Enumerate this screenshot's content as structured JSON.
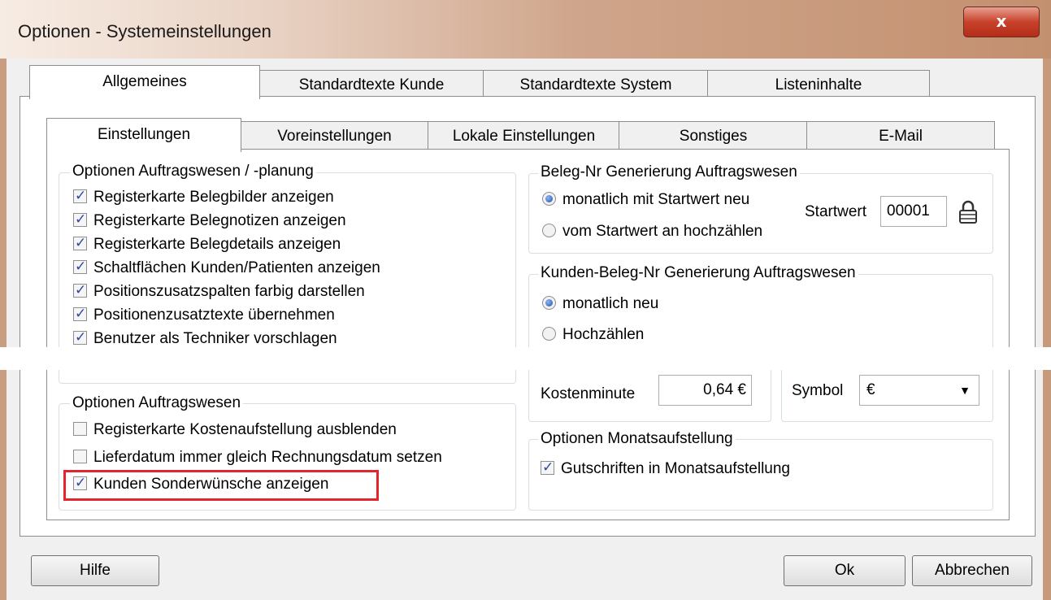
{
  "window": {
    "title": "Optionen - Systemeinstellungen",
    "close": "x"
  },
  "main_tabs": [
    "Allgemeines",
    "Standardtexte Kunde",
    "Standardtexte System",
    "Listeninhalte"
  ],
  "sub_tabs": [
    "Einstellungen",
    "Voreinstellungen",
    "Lokale Einstellungen",
    "Sonstiges",
    "E-Mail"
  ],
  "group_planung": {
    "legend": "Optionen Auftragswesen / -planung",
    "items": [
      {
        "label": "Registerkarte Belegbilder anzeigen",
        "checked": true
      },
      {
        "label": "Registerkarte Belegnotizen anzeigen",
        "checked": true
      },
      {
        "label": "Registerkarte Belegdetails anzeigen",
        "checked": true
      },
      {
        "label": "Schaltflächen Kunden/Patienten anzeigen",
        "checked": true
      },
      {
        "label": "Positionszusatzspalten farbig darstellen",
        "checked": true
      },
      {
        "label": "Positionenzusatztexte übernehmen",
        "checked": true
      },
      {
        "label": "Benutzer als Techniker vorschlagen",
        "checked": true
      }
    ]
  },
  "group_auftragswesen": {
    "legend": "Optionen Auftragswesen",
    "items": [
      {
        "label": "Registerkarte Kostenaufstellung ausblenden",
        "checked": false
      },
      {
        "label": "Lieferdatum immer gleich Rechnungsdatum setzen",
        "checked": false
      },
      {
        "label": "Kunden Sonderwünsche anzeigen",
        "checked": true
      }
    ]
  },
  "group_belegnr": {
    "legend": "Beleg-Nr Generierung Auftragswesen",
    "radio1": "monatlich mit Startwert neu",
    "radio2": "vom Startwert an hochzählen",
    "startwert_label": "Startwert",
    "startwert_value": "00001"
  },
  "group_kundenbeleg": {
    "legend": "Kunden-Beleg-Nr Generierung Auftragswesen",
    "radio1": "monatlich neu",
    "radio2": "Hochzählen"
  },
  "kosten": {
    "label": "Kostenminute",
    "value": "0,64 €",
    "symbol_label": "Symbol",
    "symbol_value": "€"
  },
  "group_monat": {
    "legend": "Optionen Monatsaufstellung",
    "item": {
      "label": "Gutschriften in Monatsaufstellung",
      "checked": true
    }
  },
  "buttons": {
    "help": "Hilfe",
    "ok": "Ok",
    "cancel": "Abbrechen"
  },
  "colors": {
    "highlight": "#e3262e",
    "title_gradient_end": "#c3906f"
  }
}
